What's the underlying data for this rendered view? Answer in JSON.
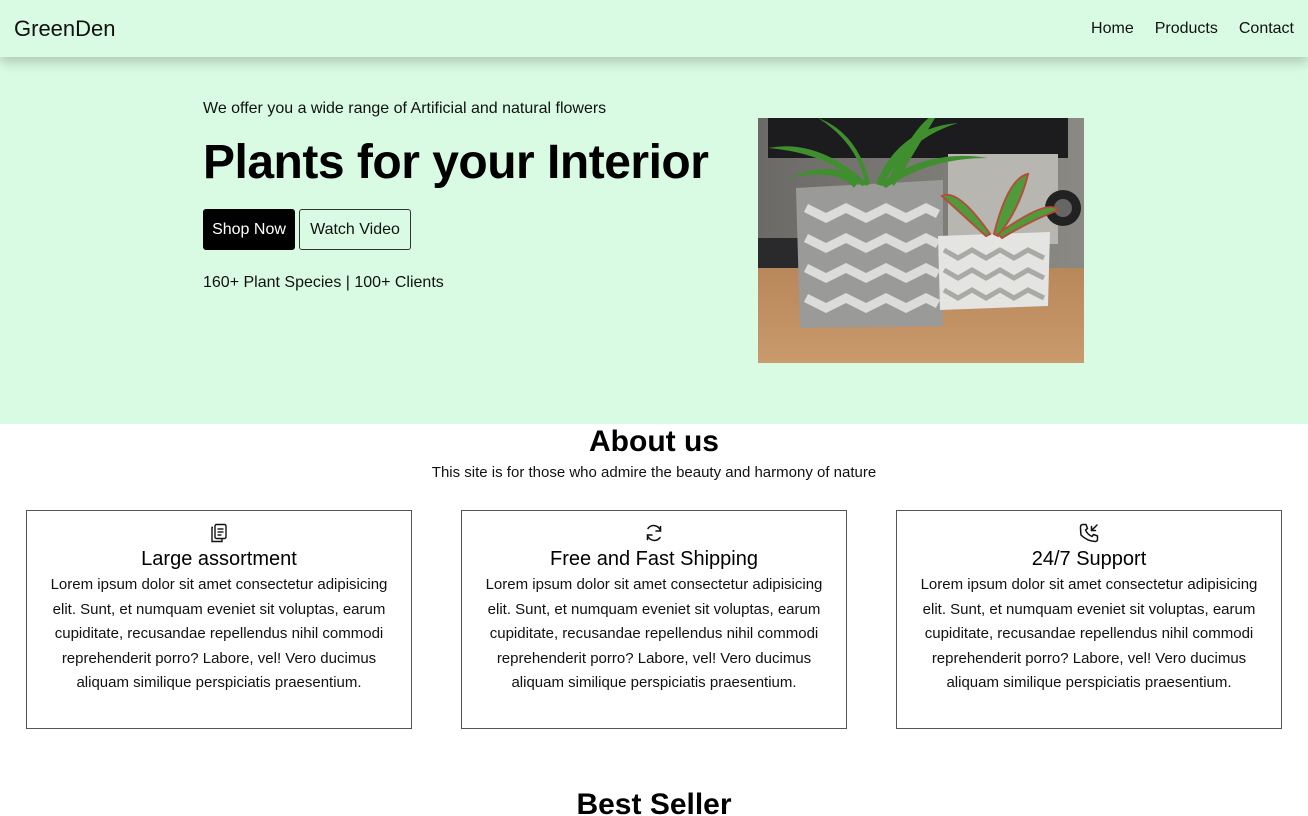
{
  "nav": {
    "brand": "GreenDen",
    "links": [
      "Home",
      "Products",
      "Contact"
    ]
  },
  "hero": {
    "tagline": "We offer you a wide range of Artificial and natural flowers",
    "title": "Plants for your Interior",
    "primary_button": "Shop Now",
    "secondary_button": "Watch Video",
    "stats": "160+ Plant Species | 100+ Clients"
  },
  "about": {
    "title": "About us",
    "subtitle": "This site is for those who admire the beauty and harmony of nature",
    "cards": [
      {
        "icon": "clipboard-icon",
        "title": "Large assortment",
        "text": "Lorem ipsum dolor sit amet consectetur adipisicing elit. Sunt, et numquam eveniet sit voluptas, earum cupiditate, recusandae repellendus nihil commodi reprehenderit porro? Labore, vel! Vero ducimus aliquam similique perspiciatis praesentium."
      },
      {
        "icon": "refresh-icon",
        "title": "Free and Fast Shipping",
        "text": "Lorem ipsum dolor sit amet consectetur adipisicing elit. Sunt, et numquam eveniet sit voluptas, earum cupiditate, recusandae repellendus nihil commodi reprehenderit porro? Labore, vel! Vero ducimus aliquam similique perspiciatis praesentium."
      },
      {
        "icon": "phone-incoming-icon",
        "title": "24/7 Support",
        "text": "Lorem ipsum dolor sit amet consectetur adipisicing elit. Sunt, et numquam eveniet sit voluptas, earum cupiditate, recusandae repellendus nihil commodi reprehenderit porro? Labore, vel! Vero ducimus aliquam similique perspiciatis praesentium."
      }
    ]
  },
  "best_seller": {
    "title": "Best Seller"
  },
  "colors": {
    "hero_background": "#d9fbe3",
    "primary_button": "#000000"
  }
}
